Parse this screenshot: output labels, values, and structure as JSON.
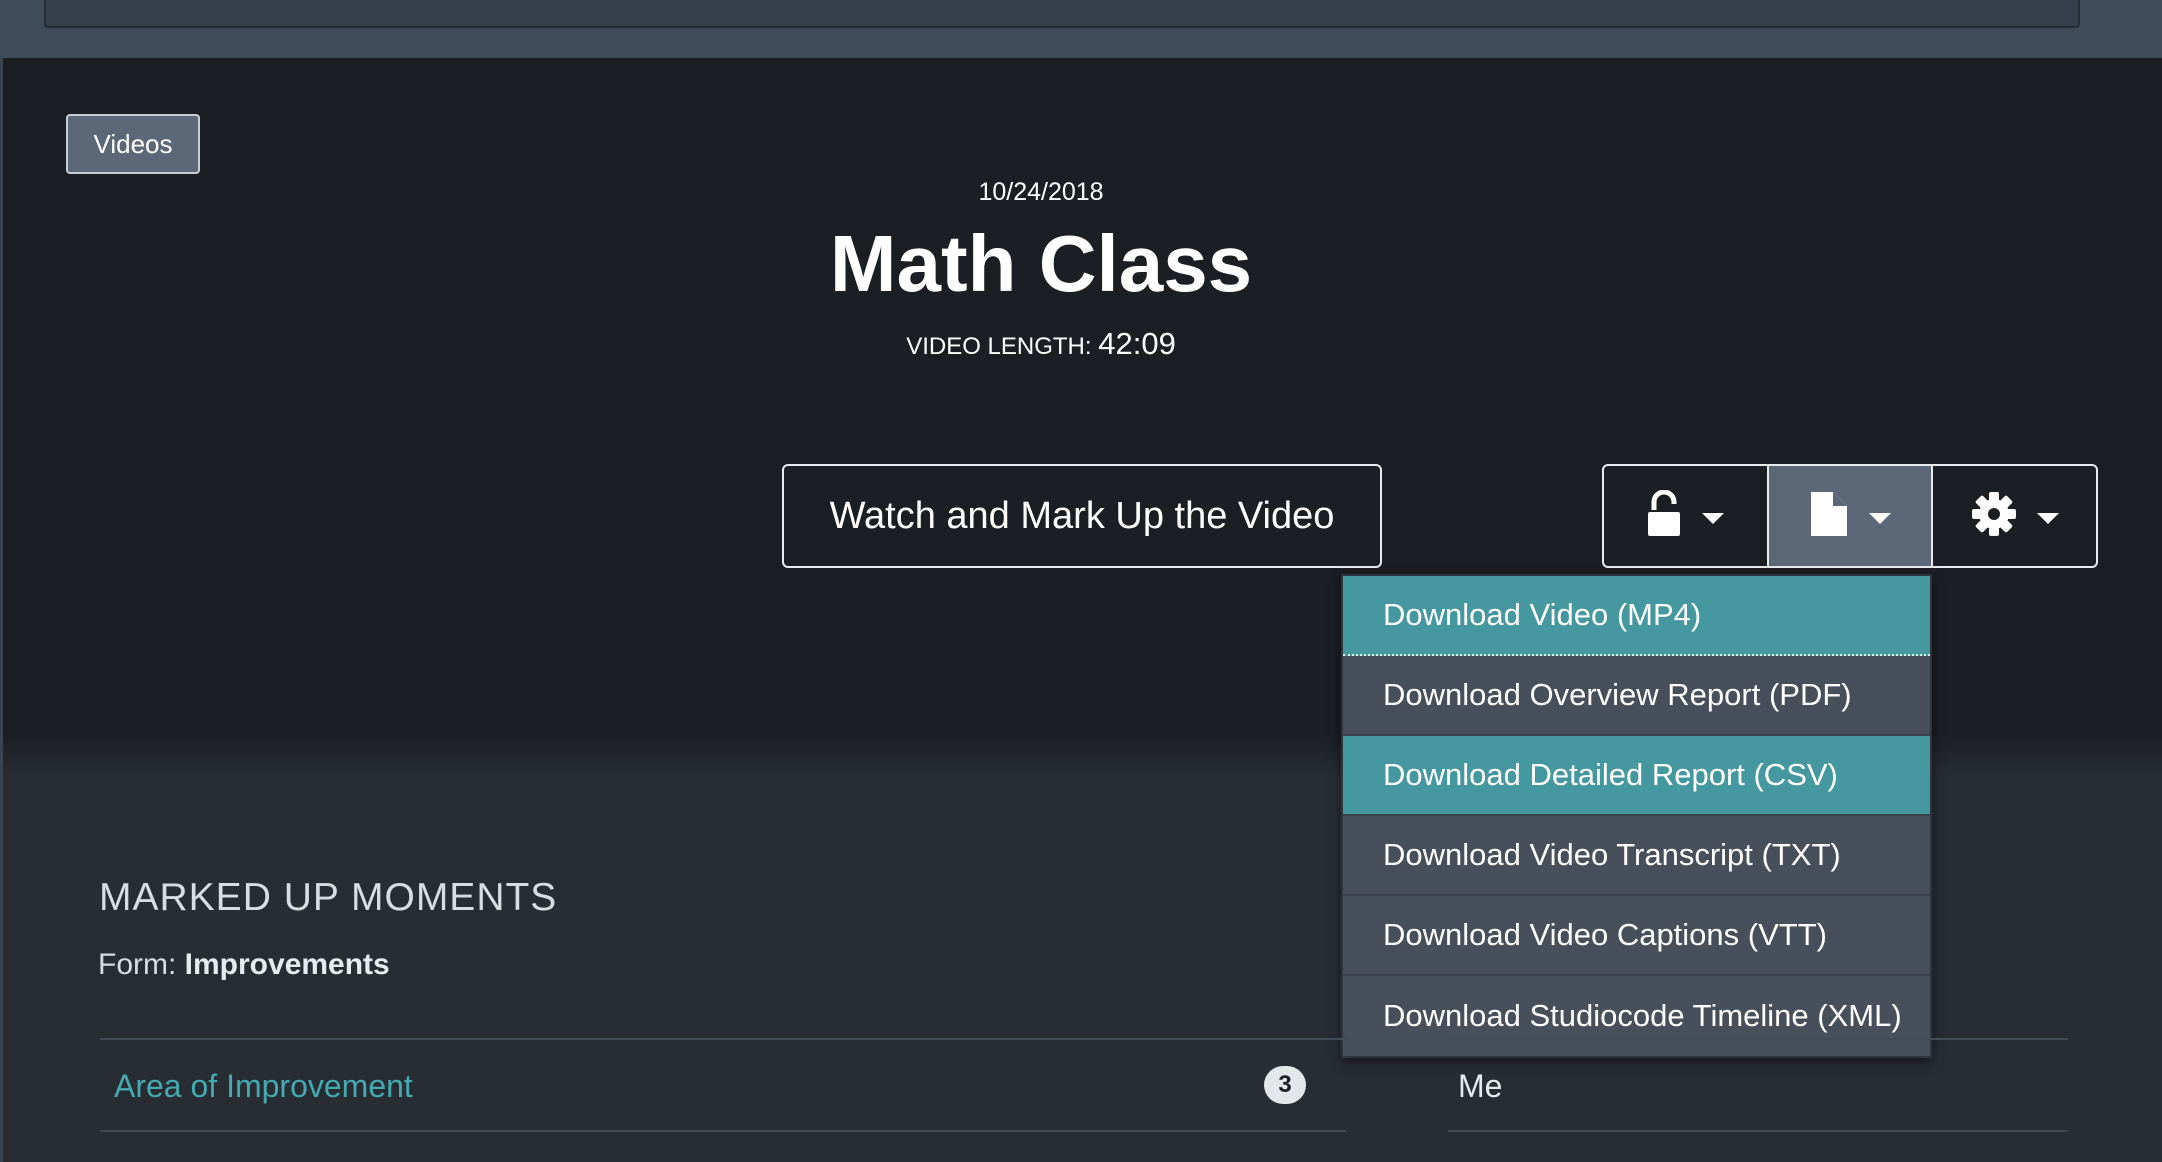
{
  "nav": {
    "videos_label": "Videos"
  },
  "video": {
    "date": "10/24/2018",
    "title": "Math Class",
    "length_label": "VIDEO LENGTH:",
    "length_value": "42:09"
  },
  "actions": {
    "watch_label": "Watch and Mark Up the Video",
    "group": [
      {
        "icon": "unlock-icon"
      },
      {
        "icon": "file-icon"
      },
      {
        "icon": "gear-icon"
      }
    ]
  },
  "download_menu": {
    "items": [
      {
        "label": "Download Video (MP4)"
      },
      {
        "label": "Download Overview Report (PDF)"
      },
      {
        "label": "Download Detailed Report (CSV)"
      },
      {
        "label": "Download Video Transcript (TXT)"
      },
      {
        "label": "Download Video Captions (VTT)"
      },
      {
        "label": "Download Studiocode Timeline (XML)"
      }
    ]
  },
  "moments": {
    "heading": "MARKED UP MOMENTS",
    "form_label": "Form:",
    "form_name": "Improvements",
    "rows": [
      {
        "name": "Area of Improvement",
        "count": "3",
        "owner": "Me"
      }
    ]
  },
  "colors": {
    "accent": "#45989f",
    "link": "#45a9b0",
    "background": "#1b1e22",
    "panel": "#282d34"
  }
}
